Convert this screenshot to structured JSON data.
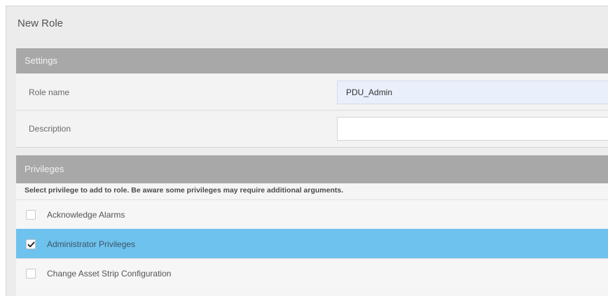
{
  "dialog": {
    "title": "New Role"
  },
  "settings": {
    "header": "Settings",
    "role_name": {
      "label": "Role name",
      "value": "PDU_Admin"
    },
    "description": {
      "label": "Description",
      "value": ""
    }
  },
  "privileges": {
    "header": "Privileges",
    "instructions": "Select privilege to add to role. Be aware some privileges may require additional arguments.",
    "items": [
      {
        "label": "Acknowledge Alarms",
        "checked": false,
        "selected": false
      },
      {
        "label": "Administrator Privileges",
        "checked": true,
        "selected": true
      },
      {
        "label": "Change Asset Strip Configuration",
        "checked": false,
        "selected": false
      }
    ]
  },
  "colors": {
    "selected_row": "#6ec2ee",
    "section_header": "#a8a8a8"
  }
}
